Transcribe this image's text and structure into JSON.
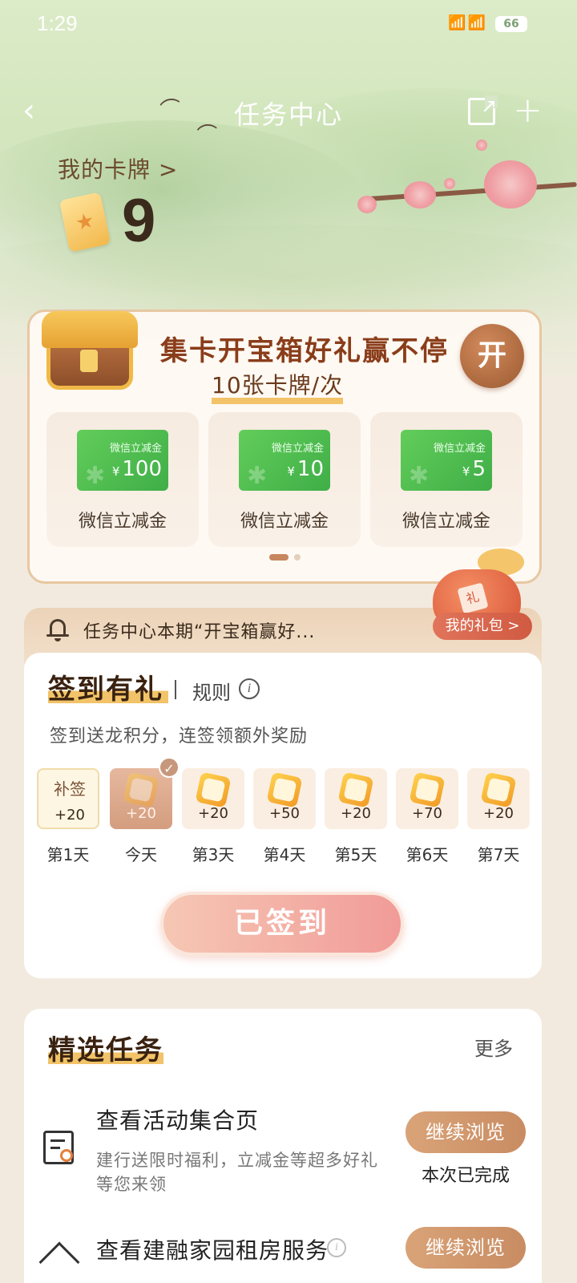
{
  "status_bar": {
    "time": "1:29",
    "battery": "66"
  },
  "nav": {
    "title": "任务中心"
  },
  "my_cards": {
    "link_label": "我的卡牌 >",
    "count": "9"
  },
  "chest": {
    "title": "集卡开宝箱好礼赢不停",
    "subtitle": "10张卡牌/次",
    "open_label": "开",
    "rewards": [
      {
        "voucher_label": "微信立减金",
        "currency": "¥",
        "amount": "100",
        "name": "微信立减金"
      },
      {
        "voucher_label": "微信立减金",
        "currency": "¥",
        "amount": "10",
        "name": "微信立减金"
      },
      {
        "voucher_label": "微信立减金",
        "currency": "¥",
        "amount": "5",
        "name": "微信立减金"
      }
    ],
    "gift_tag": "礼"
  },
  "notice": {
    "text": "任务中心本期“开宝箱赢好...",
    "my_gift_label": "我的礼包 >"
  },
  "signin": {
    "title": "签到有礼",
    "rules_label": "规则",
    "description": "签到送龙积分，连签领额外奖励",
    "makeup_label": "补签",
    "days": [
      {
        "label": "第1天",
        "value": "+20"
      },
      {
        "label": "今天",
        "value": "+20"
      },
      {
        "label": "第3天",
        "value": "+20"
      },
      {
        "label": "第4天",
        "value": "+50"
      },
      {
        "label": "第5天",
        "value": "+20"
      },
      {
        "label": "第6天",
        "value": "+70"
      },
      {
        "label": "第7天",
        "value": "+20"
      }
    ],
    "signed_button": "已签到"
  },
  "tasks": {
    "title": "精选任务",
    "more_label": "更多",
    "items": [
      {
        "name": "查看活动集合页",
        "desc": "建行送限时福利，立减金等超多好礼等您来领",
        "button": "继续浏览",
        "status": "本次已完成"
      },
      {
        "name": "查看建融家园租房服务",
        "button": "继续浏览"
      }
    ]
  },
  "colors": {
    "accent": "#c98c62",
    "brand_green": "#3fae47",
    "signed_pink": "#f19b98"
  }
}
